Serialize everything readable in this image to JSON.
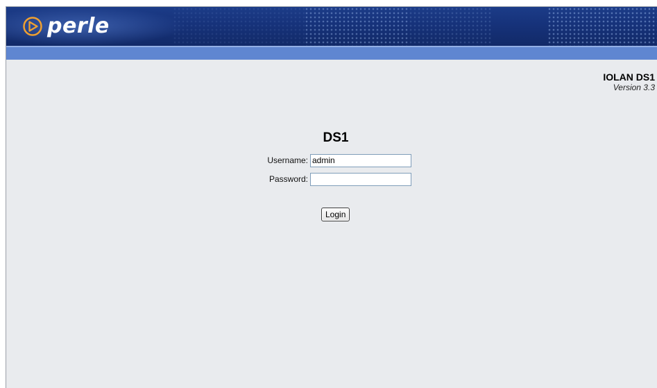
{
  "header": {
    "brand_text": "perle"
  },
  "product": {
    "name": "IOLAN DS1",
    "version": "Version 3.3"
  },
  "login_form": {
    "device_title": "DS1",
    "username_label": "Username:",
    "username_value": "admin",
    "password_label": "Password:",
    "password_value": "",
    "login_button_label": "Login"
  },
  "colors": {
    "banner_blue": "#16327a",
    "subbar_blue": "#5f86d1",
    "page_background": "#e9ebee"
  },
  "icons": {
    "logo": "perle-logo-icon"
  }
}
